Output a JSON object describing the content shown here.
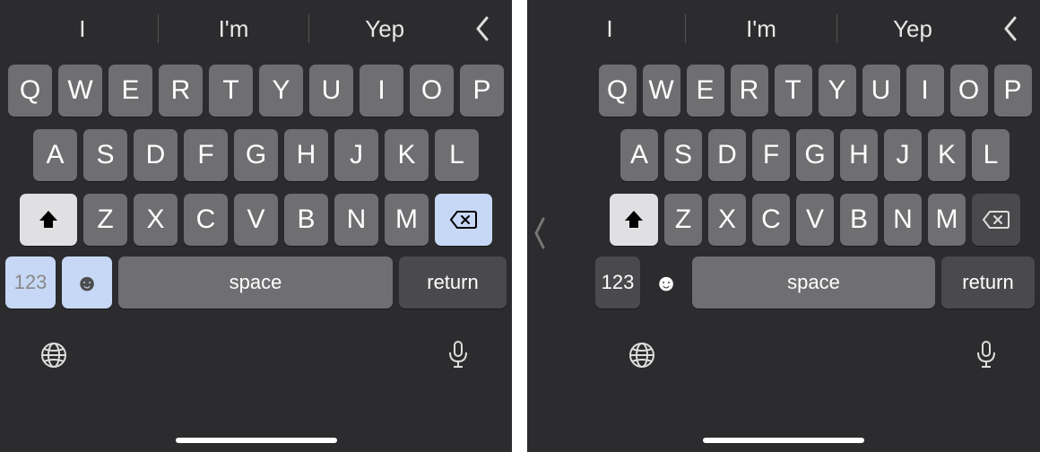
{
  "suggestions": [
    "I",
    "I'm",
    "Yep"
  ],
  "rows": {
    "r1": [
      "Q",
      "W",
      "E",
      "R",
      "T",
      "Y",
      "U",
      "I",
      "O",
      "P"
    ],
    "r2": [
      "A",
      "S",
      "D",
      "F",
      "G",
      "H",
      "J",
      "K",
      "L"
    ],
    "r3": [
      "Z",
      "X",
      "C",
      "V",
      "B",
      "N",
      "M"
    ]
  },
  "labels": {
    "numbers": "123",
    "space": "space",
    "return": "return"
  }
}
